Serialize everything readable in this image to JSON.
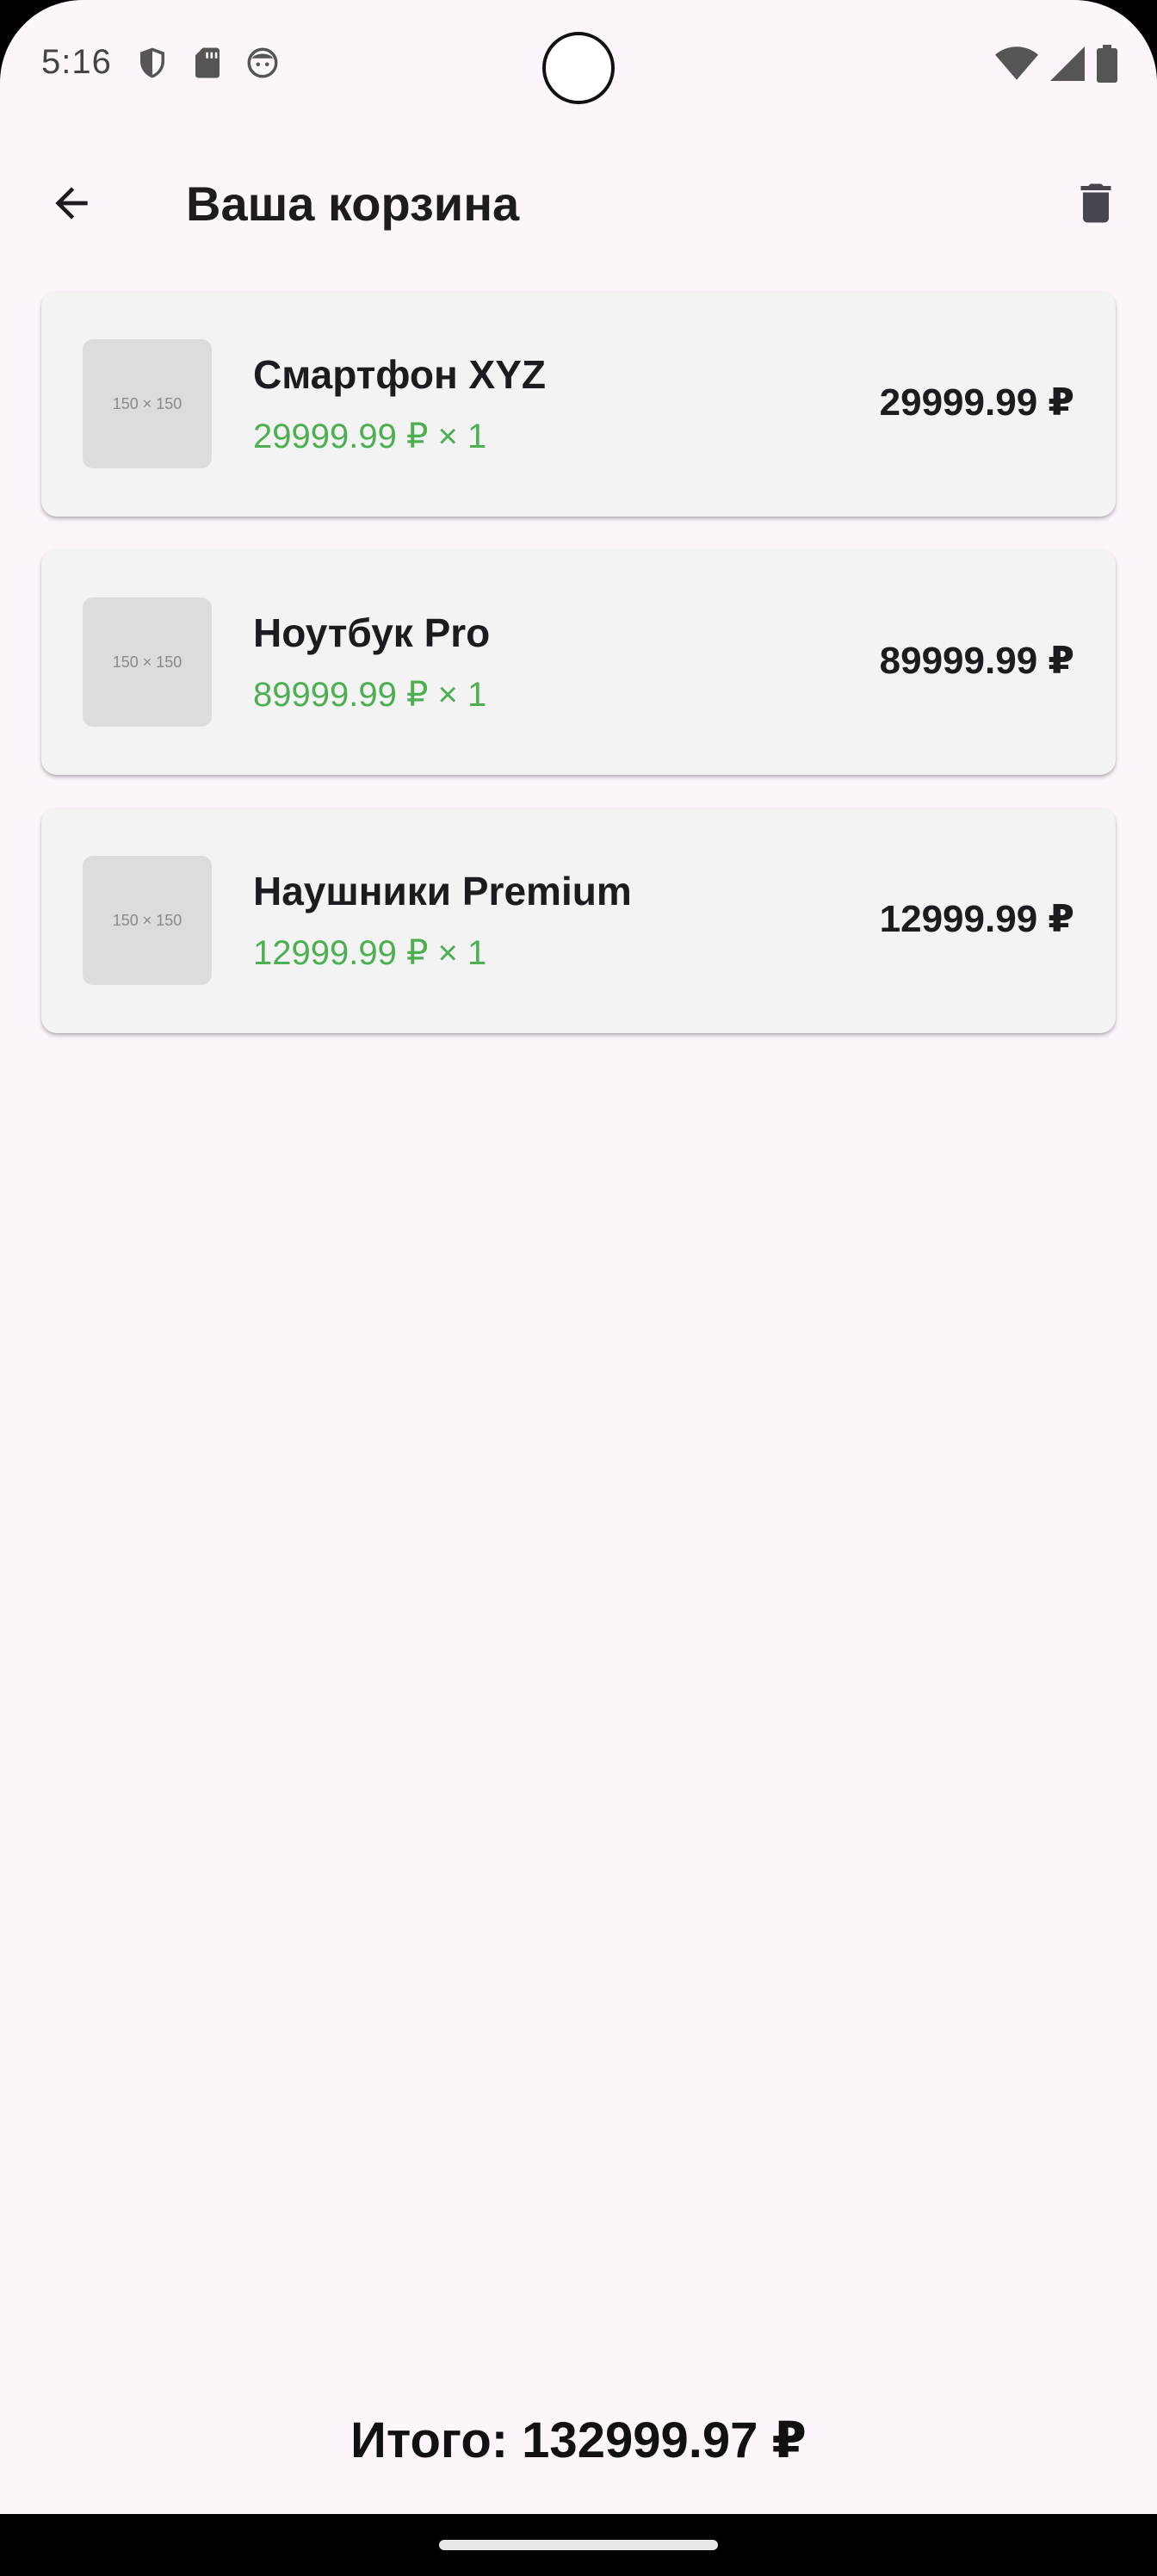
{
  "status_bar": {
    "time": "5:16",
    "left_icons": [
      "shield-icon",
      "sd-card-icon",
      "face-icon"
    ],
    "right_icons": [
      "wifi-icon",
      "cellular-signal-icon",
      "battery-icon"
    ]
  },
  "app_bar": {
    "title": "Ваша корзина",
    "back_icon": "arrow-back-icon",
    "clear_icon": "trash-icon"
  },
  "cart": {
    "items": [
      {
        "image_placeholder": "150 × 150",
        "name": "Смартфон XYZ",
        "price_qty": "29999.99 ₽ × 1",
        "total": "29999.99 ₽"
      },
      {
        "image_placeholder": "150 × 150",
        "name": "Ноутбук Pro",
        "price_qty": "89999.99 ₽ × 1",
        "total": "89999.99 ₽"
      },
      {
        "image_placeholder": "150 × 150",
        "name": "Наушники Premium",
        "price_qty": "12999.99 ₽ × 1",
        "total": "12999.99 ₽"
      }
    ]
  },
  "footer": {
    "grand_total": "Итого: 132999.97 ₽"
  },
  "colors": {
    "background": "#fcf5fc",
    "card": "#f4f3f4",
    "price_accent": "#4caf50",
    "text": "#1d1b20"
  }
}
